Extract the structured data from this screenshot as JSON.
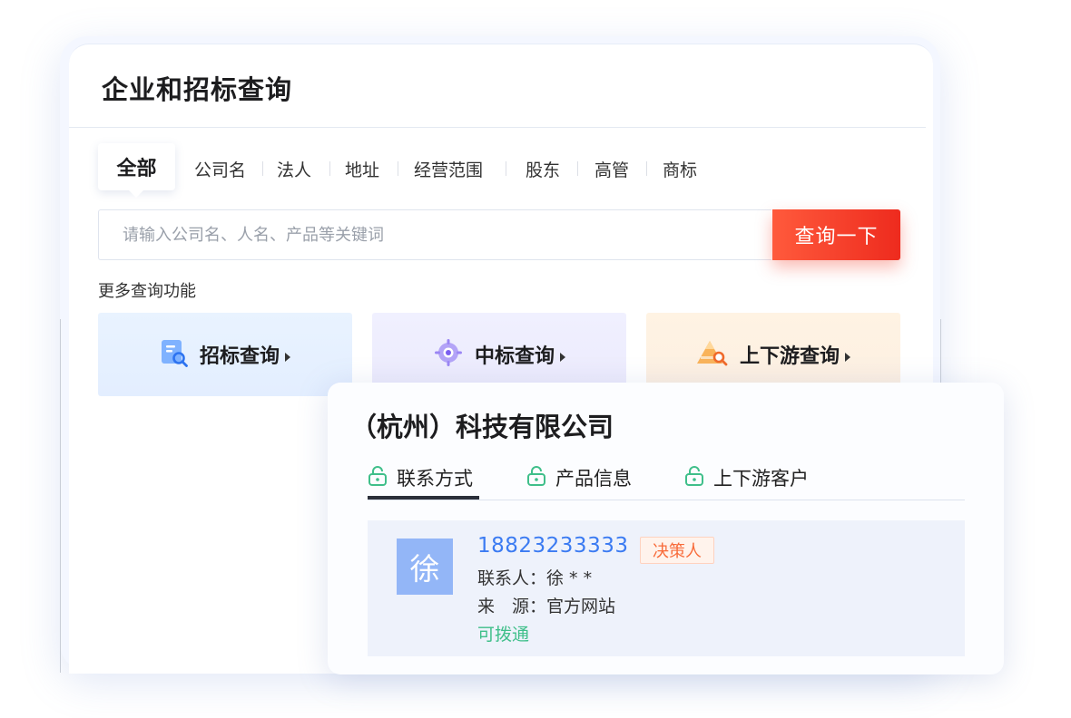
{
  "main": {
    "title": "企业和招标查询",
    "tabs": [
      "全部",
      "公司名",
      "法人",
      "地址",
      "经营范围",
      "股东",
      "高管",
      "商标"
    ],
    "search": {
      "placeholder": "请输入公司名、人名、产品等关键词",
      "button_label": "查询一下"
    },
    "more_label": "更多查询功能",
    "features": [
      {
        "label": "招标查询",
        "icon": "document-search-icon"
      },
      {
        "label": "中标查询",
        "icon": "target-icon"
      },
      {
        "label": "上下游查询",
        "icon": "pyramid-search-icon"
      }
    ]
  },
  "overlay": {
    "company_name": "（杭州）科技有限公司",
    "tabs": [
      {
        "label": "联系方式",
        "icon": "lock-open-icon"
      },
      {
        "label": "产品信息",
        "icon": "lock-open-icon"
      },
      {
        "label": "上下游客户",
        "icon": "lock-open-icon"
      }
    ],
    "contact": {
      "avatar_char": "徐",
      "phone": "18823233333",
      "badge": "决策人",
      "person_line": "联系人：徐 * *",
      "source_line": "来　源：官方网站",
      "status": "可拨通"
    }
  },
  "colors": {
    "accent_red": "#ee2b1e",
    "link_blue": "#3b7bf2",
    "status_green": "#3fbf8a",
    "badge_orange": "#f86b3a",
    "avatar_blue": "#93b6f7"
  }
}
